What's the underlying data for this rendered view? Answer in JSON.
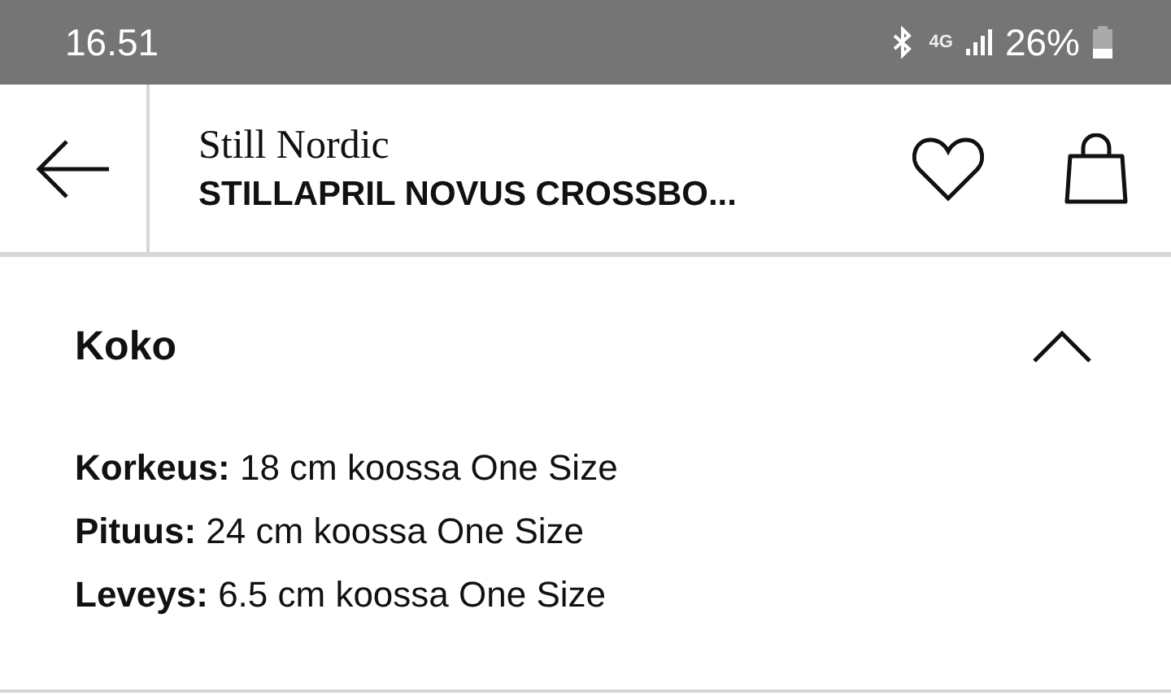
{
  "status_bar": {
    "time": "16.51",
    "network": "4G",
    "battery": "26%"
  },
  "header": {
    "brand": "Still Nordic",
    "product": "STILLAPRIL NOVUS CROSSBO..."
  },
  "section": {
    "title": "Koko",
    "expanded": true,
    "details": [
      "**Korkeus:** 18 cm koossa One Size",
      "**Pituus:** 24 cm koossa One Size",
      "**Leveys:** 6.5 cm koossa One Size"
    ]
  }
}
